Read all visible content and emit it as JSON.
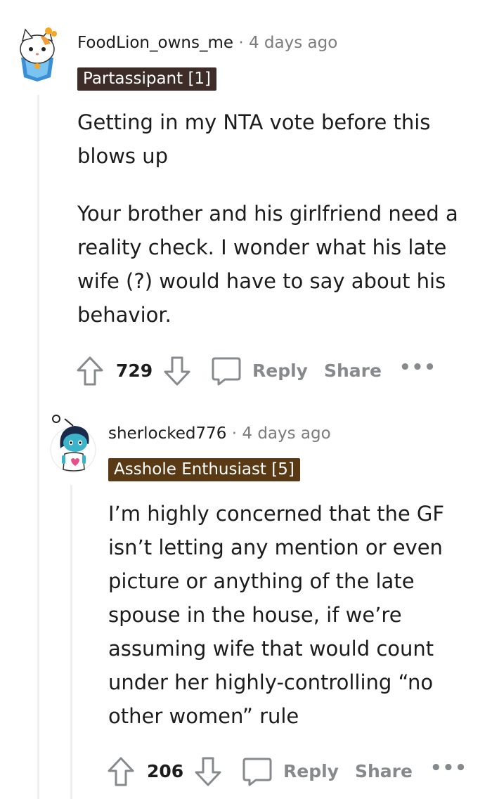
{
  "comments": [
    {
      "username": "FoodLion_owns_me",
      "separator": "·",
      "time": "4 days ago",
      "flair": "Partassipant [1]",
      "flair_color": "#3d2c27",
      "paragraphs": [
        "Getting in my NTA vote before this blows up",
        "Your brother and his girlfriend need a reality check. I wonder what his late wife (?) would have to say about his behavior."
      ],
      "votes": "729",
      "reply_label": "Reply",
      "share_label": "Share",
      "more_label": "•••"
    },
    {
      "username": "sherlocked776",
      "separator": "·",
      "time": "4 days ago",
      "flair": "Asshole Enthusiast [5]",
      "flair_color": "#5a3a14",
      "paragraphs": [
        "I’m highly concerned that the GF isn’t letting any mention or even picture or anything of the late spouse in the house, if we’re assuming wife that would count under her highly-controlling “no other women” rule"
      ],
      "votes": "206",
      "reply_label": "Reply",
      "share_label": "Share",
      "more_label": "•••"
    }
  ],
  "icons": {
    "upvote": "upvote-arrow-icon",
    "downvote": "downvote-arrow-icon",
    "reply": "speech-bubble-icon",
    "more": "more-dots-icon"
  },
  "colors": {
    "thread_line": "#edeff1",
    "action_gray": "#878a8c",
    "meta_gray": "#7c7c7c"
  }
}
